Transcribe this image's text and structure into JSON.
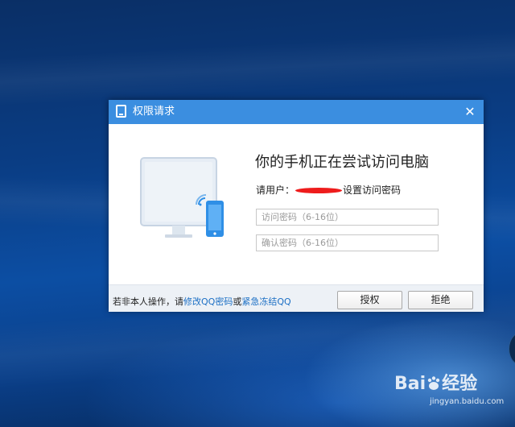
{
  "dialog": {
    "title": "权限请求",
    "heading": "你的手机正在尝试访问电脑",
    "prompt_prefix": "请用户：",
    "prompt_suffix": "设置访问密码",
    "password_placeholder": "访问密码（6-16位）",
    "confirm_placeholder": "确认密码（6-16位）",
    "footer": {
      "prefix": "若非本人操作，请",
      "link_change": "修改QQ密码",
      "middle": "或",
      "link_freeze": "紧急冻结QQ"
    },
    "buttons": {
      "grant": "授权",
      "deny": "拒绝"
    }
  },
  "watermark": {
    "logo_left": "Bai",
    "logo_right": "经验",
    "url": "jingyan.baidu.com"
  },
  "colors": {
    "titlebar": "#3b8ee0",
    "link": "#1a6ec4",
    "phone": "#2f8fe6",
    "redaction": "#ee1c1c"
  }
}
